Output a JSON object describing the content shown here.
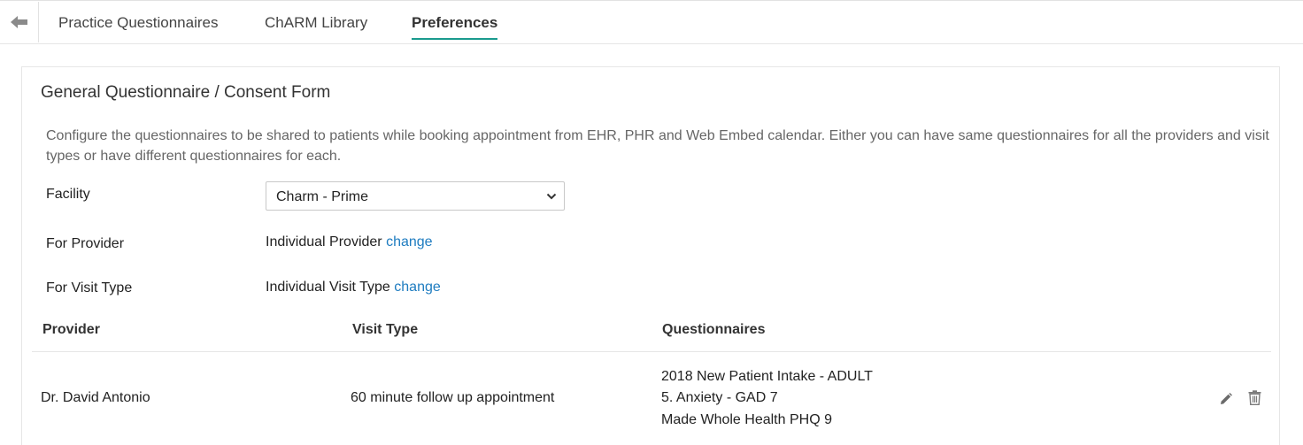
{
  "nav": {
    "back_icon": "back-arrow-icon",
    "tabs": [
      {
        "label": "Practice Questionnaires"
      },
      {
        "label": "ChARM Library"
      },
      {
        "label": "Preferences"
      }
    ],
    "active_tab": "Preferences",
    "accent_color": "#1a9b8e"
  },
  "section": {
    "title": "General Questionnaire / Consent Form",
    "description": "Configure the questionnaires to be shared to patients while booking appointment from EHR, PHR and Web Embed calendar. Either you can have same questionnaires for all the providers and visit types or have different questionnaires for each."
  },
  "form": {
    "facility_label": "Facility",
    "facility_value": "Charm - Prime",
    "provider_label": "For Provider",
    "provider_value": "Individual Provider",
    "provider_change": "change",
    "visit_type_label": "For Visit Type",
    "visit_type_value": "Individual Visit Type",
    "visit_type_change": "change",
    "link_color": "#1e7cc0"
  },
  "table": {
    "headers": [
      "Provider",
      "Visit Type",
      "Questionnaires"
    ],
    "rows": [
      {
        "provider": "Dr. David Antonio",
        "visit_type": "60 minute follow up appointment",
        "questionnaires": [
          "2018 New Patient Intake - ADULT",
          "5. Anxiety - GAD 7",
          "Made Whole Health PHQ 9"
        ],
        "actions": [
          "edit-icon",
          "delete-icon"
        ]
      }
    ]
  }
}
